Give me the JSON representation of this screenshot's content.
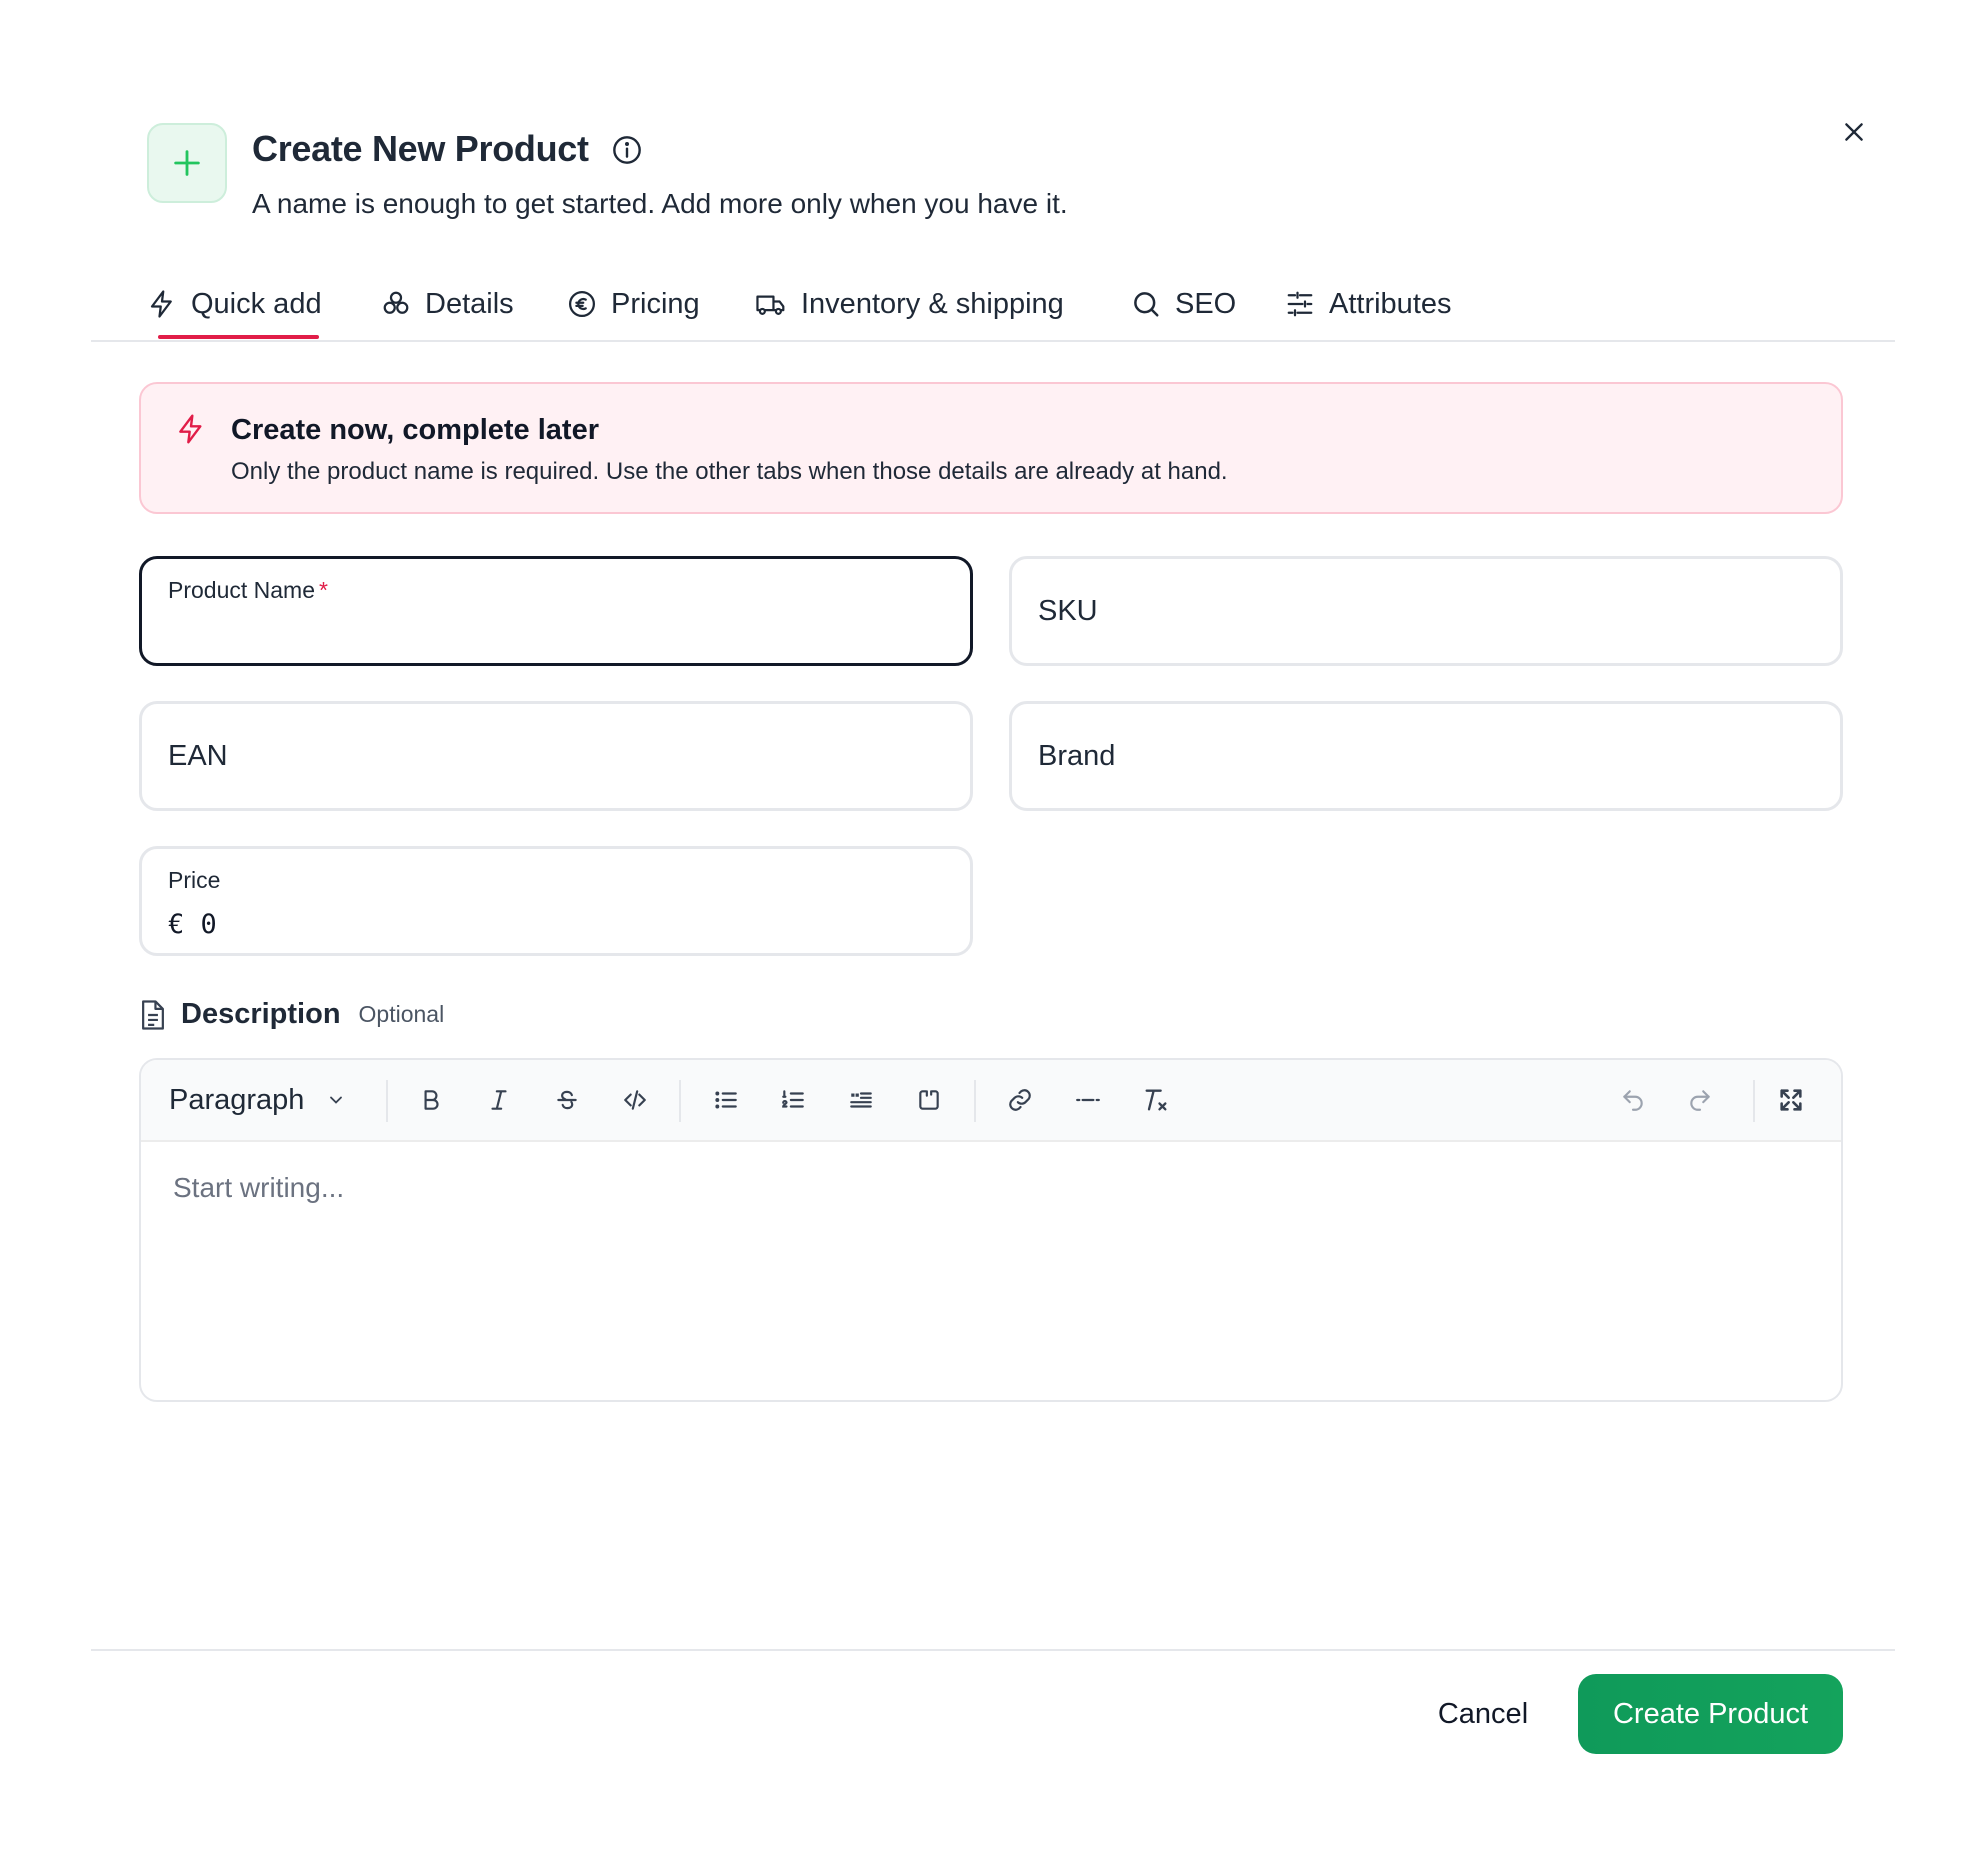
{
  "header": {
    "title": "Create New Product",
    "subtitle": "A name is enough to get started. Add more only when you have it.",
    "icon": "plus-icon",
    "info_icon": "info-icon",
    "close_icon": "close-icon"
  },
  "tabs": [
    {
      "label": "Quick add",
      "icon": "lightning-icon",
      "active": true
    },
    {
      "label": "Details",
      "icon": "shapes-icon",
      "active": false
    },
    {
      "label": "Pricing",
      "icon": "euro-circle-icon",
      "active": false
    },
    {
      "label": "Inventory & shipping",
      "icon": "truck-icon",
      "active": false
    },
    {
      "label": "SEO",
      "icon": "search-icon",
      "active": false
    },
    {
      "label": "Attributes",
      "icon": "sliders-icon",
      "active": false
    }
  ],
  "banner": {
    "title": "Create now, complete later",
    "text": "Only the product name is required. Use the other tabs when those details are already at hand."
  },
  "fields": {
    "product_name": {
      "label": "Product Name",
      "required_mark": "*",
      "value": ""
    },
    "sku": {
      "label": "SKU",
      "value": ""
    },
    "ean": {
      "label": "EAN",
      "value": ""
    },
    "brand": {
      "label": "Brand",
      "value": ""
    },
    "price": {
      "label": "Price",
      "value": "€ 0"
    }
  },
  "description": {
    "label": "Description",
    "optional": "Optional",
    "block_type": "Paragraph",
    "placeholder": "Start writing..."
  },
  "footer": {
    "cancel_label": "Cancel",
    "create_label": "Create Product"
  },
  "colors": {
    "accent": "#e11d48",
    "primary_button": "#0f9a5a",
    "banner_bg": "#fff1f4",
    "icon_green": "#22c55e"
  }
}
